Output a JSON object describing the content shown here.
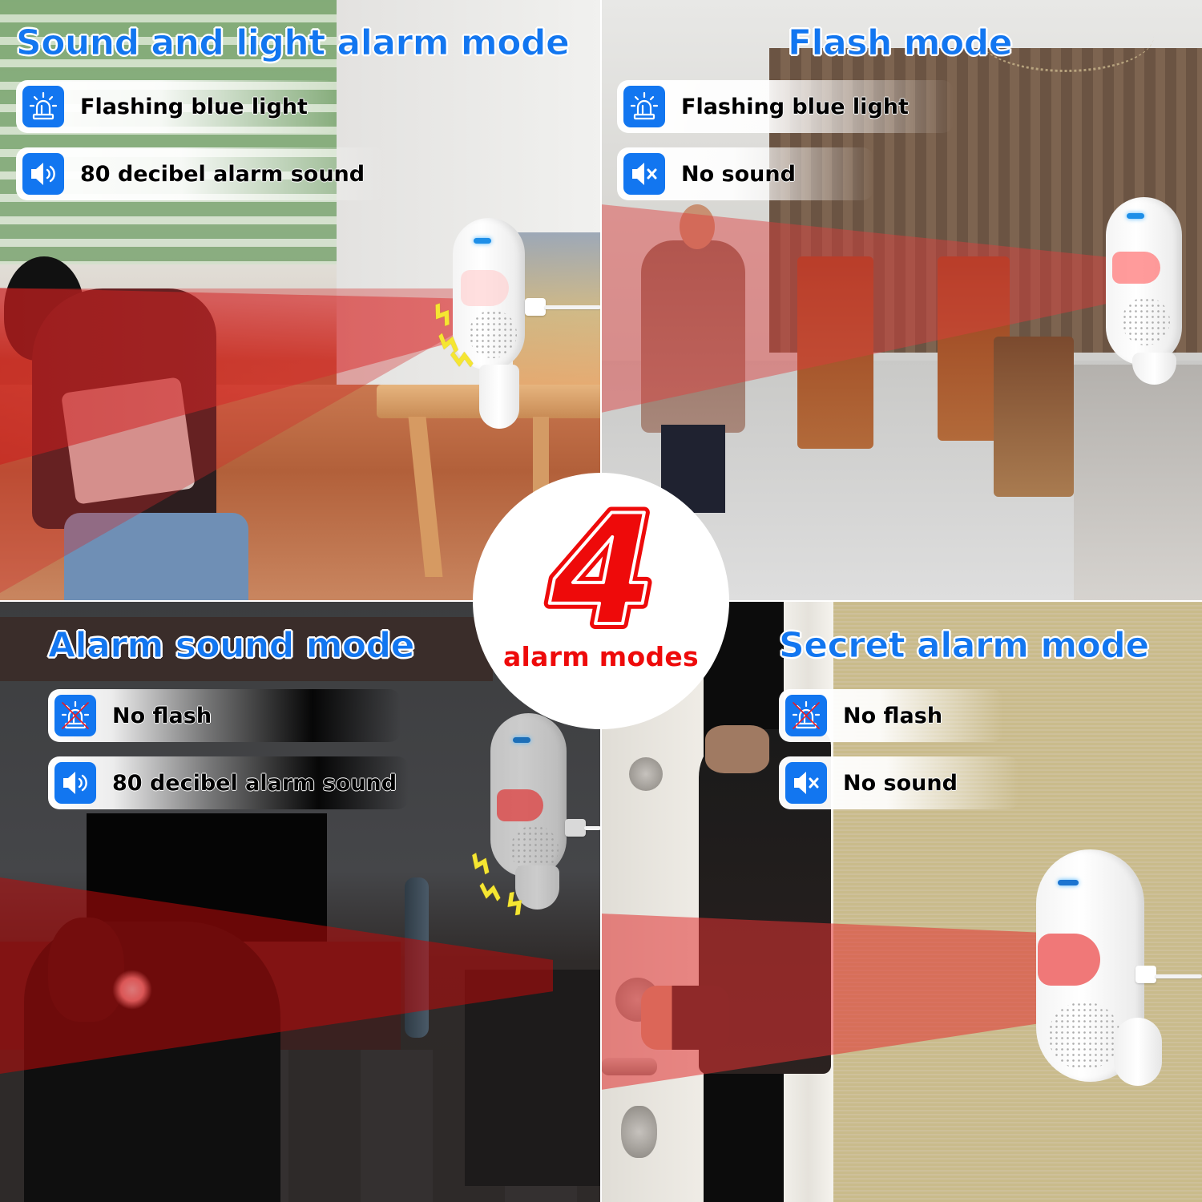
{
  "badge": {
    "number": "4",
    "caption": "alarm modes",
    "color": "#ee0a0a"
  },
  "accent_color": "#1276f0",
  "modes": [
    {
      "title": "Sound and light alarm mode",
      "features": [
        {
          "icon": "siren-icon",
          "label": "Flashing blue light"
        },
        {
          "icon": "speaker-icon",
          "label": "80 decibel alarm sound"
        }
      ]
    },
    {
      "title": "Flash mode",
      "features": [
        {
          "icon": "siren-icon",
          "label": "Flashing blue light"
        },
        {
          "icon": "speaker-muted-icon",
          "label": "No sound"
        }
      ]
    },
    {
      "title": "Alarm sound mode",
      "features": [
        {
          "icon": "siren-off-icon",
          "label": "No flash"
        },
        {
          "icon": "speaker-icon",
          "label": "80 decibel alarm sound"
        }
      ]
    },
    {
      "title": "Secret alarm mode",
      "features": [
        {
          "icon": "siren-off-icon",
          "label": "No flash"
        },
        {
          "icon": "speaker-muted-icon",
          "label": "No sound"
        }
      ]
    }
  ]
}
